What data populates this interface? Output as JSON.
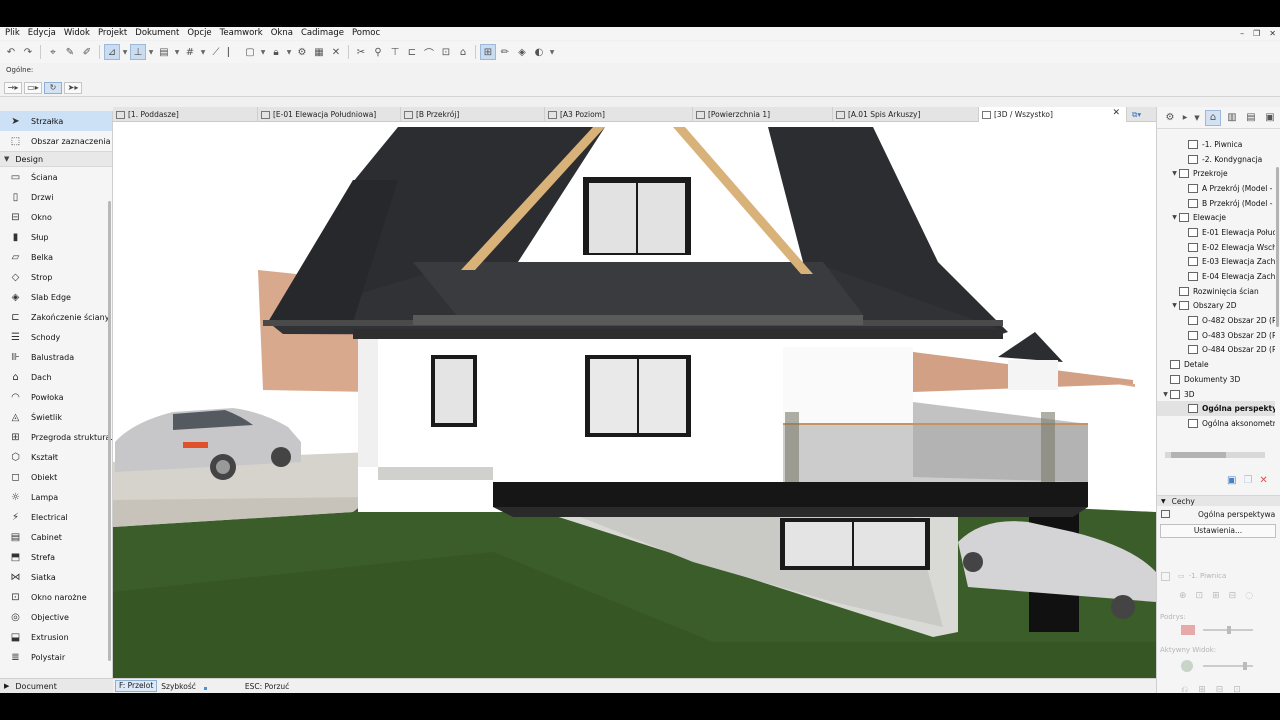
{
  "menu": {
    "items": [
      "Plik",
      "Edycja",
      "Widok",
      "Projekt",
      "Dokument",
      "Opcje",
      "Teamwork",
      "Okna",
      "Cadimage",
      "Pomoc"
    ],
    "window_controls": [
      "–",
      "❐",
      "✕"
    ]
  },
  "infobox": {
    "label": "Ogólne:"
  },
  "toolbox": {
    "top_tools": [
      {
        "label": "Strzałka",
        "icon": "arrow-icon"
      },
      {
        "label": "Obszar zaznaczenia",
        "icon": "marquee-icon"
      }
    ],
    "design_header": "Design",
    "design_tools": [
      {
        "label": "Ściana",
        "icon": "wall-icon"
      },
      {
        "label": "Drzwi",
        "icon": "door-icon"
      },
      {
        "label": "Okno",
        "icon": "window-icon"
      },
      {
        "label": "Słup",
        "icon": "column-icon"
      },
      {
        "label": "Belka",
        "icon": "beam-icon"
      },
      {
        "label": "Strop",
        "icon": "slab-icon"
      },
      {
        "label": "Slab Edge",
        "icon": "slab-edge-icon"
      },
      {
        "label": "Zakończenie ściany",
        "icon": "wall-end-icon"
      },
      {
        "label": "Schody",
        "icon": "stair-icon"
      },
      {
        "label": "Balustrada",
        "icon": "railing-icon"
      },
      {
        "label": "Dach",
        "icon": "roof-icon"
      },
      {
        "label": "Powłoka",
        "icon": "shell-icon"
      },
      {
        "label": "Świetlik",
        "icon": "skylight-icon"
      },
      {
        "label": "Przegroda struktura...",
        "icon": "curtain-wall-icon"
      },
      {
        "label": "Kształt",
        "icon": "morph-icon"
      },
      {
        "label": "Obiekt",
        "icon": "object-icon"
      },
      {
        "label": "Lampa",
        "icon": "lamp-icon"
      },
      {
        "label": "Electrical",
        "icon": "electrical-icon"
      },
      {
        "label": "Cabinet",
        "icon": "cabinet-icon"
      },
      {
        "label": "Strefa",
        "icon": "zone-icon"
      },
      {
        "label": "Siatka",
        "icon": "mesh-icon"
      },
      {
        "label": "Okno narożne",
        "icon": "corner-window-icon"
      },
      {
        "label": "Objective",
        "icon": "objective-icon"
      },
      {
        "label": "Extrusion",
        "icon": "extrusion-icon"
      },
      {
        "label": "Polystair",
        "icon": "polystair-icon"
      }
    ],
    "document_header": "Document"
  },
  "tabs": [
    {
      "label": "[1. Poddasze]"
    },
    {
      "label": "[E-01 Elewacja Południowa]"
    },
    {
      "label": "[B Przekrój]"
    },
    {
      "label": "[A3 Poziom]"
    },
    {
      "label": "[Powierzchnia 1]"
    },
    {
      "label": "[A.01 Spis Arkuszy]"
    },
    {
      "label": "[3D / Wszystko]",
      "active": true
    }
  ],
  "tab_close": "✕",
  "statusbar": {
    "mode": "F: Przelot",
    "speed": "Szybkość",
    "esc_hint": "ESC: Porzuć"
  },
  "navigator": {
    "tree": [
      {
        "label": "-1. Piwnica",
        "indent": 2,
        "expander": ""
      },
      {
        "label": "-2. Kondygnacja",
        "indent": 2,
        "expander": ""
      },
      {
        "label": "Przekroje",
        "indent": 1,
        "expander": "▼"
      },
      {
        "label": "A Przekrój (Model - p",
        "indent": 2,
        "expander": ""
      },
      {
        "label": "B Przekrój (Model - p",
        "indent": 2,
        "expander": ""
      },
      {
        "label": "Elewacje",
        "indent": 1,
        "expander": "▼"
      },
      {
        "label": "E-01 Elewacja Połud",
        "indent": 2,
        "expander": ""
      },
      {
        "label": "E-02 Elewacja Wscho",
        "indent": 2,
        "expander": ""
      },
      {
        "label": "E-03 Elewacja Zacho",
        "indent": 2,
        "expander": ""
      },
      {
        "label": "E-04 Elewacja Zacho",
        "indent": 2,
        "expander": ""
      },
      {
        "label": "Rozwinięcia ścian",
        "indent": 1,
        "expander": ""
      },
      {
        "label": "Obszary 2D",
        "indent": 1,
        "expander": "▼"
      },
      {
        "label": "O-482 Obszar 2D (Ry",
        "indent": 2,
        "expander": ""
      },
      {
        "label": "O-483 Obszar 2D (Ry",
        "indent": 2,
        "expander": ""
      },
      {
        "label": "O-484 Obszar 2D (Ry",
        "indent": 2,
        "expander": ""
      },
      {
        "label": "Detale",
        "indent": 0,
        "expander": ""
      },
      {
        "label": "Dokumenty 3D",
        "indent": 0,
        "expander": ""
      },
      {
        "label": "3D",
        "indent": 0,
        "expander": "▼"
      },
      {
        "label": "Ogólna perspektywa",
        "indent": 2,
        "expander": "",
        "selected": true
      },
      {
        "label": "Ogólna aksonometr",
        "indent": 2,
        "expander": ""
      }
    ],
    "properties_header": "Cechy",
    "properties_name": "Ogólna perspektywa",
    "settings_button": "Ustawienia...",
    "story_value": "-1. Piwnica",
    "label_podrys": "Podrys:",
    "label_aktywny": "Aktywny Widok:"
  },
  "colors": {
    "accent": "#cce0f6",
    "roof": "#2b2d30",
    "wall": "#ffffff",
    "grass": "#3b5d2a",
    "stone": "#d9d9d6",
    "timber": "#d9b27a"
  }
}
